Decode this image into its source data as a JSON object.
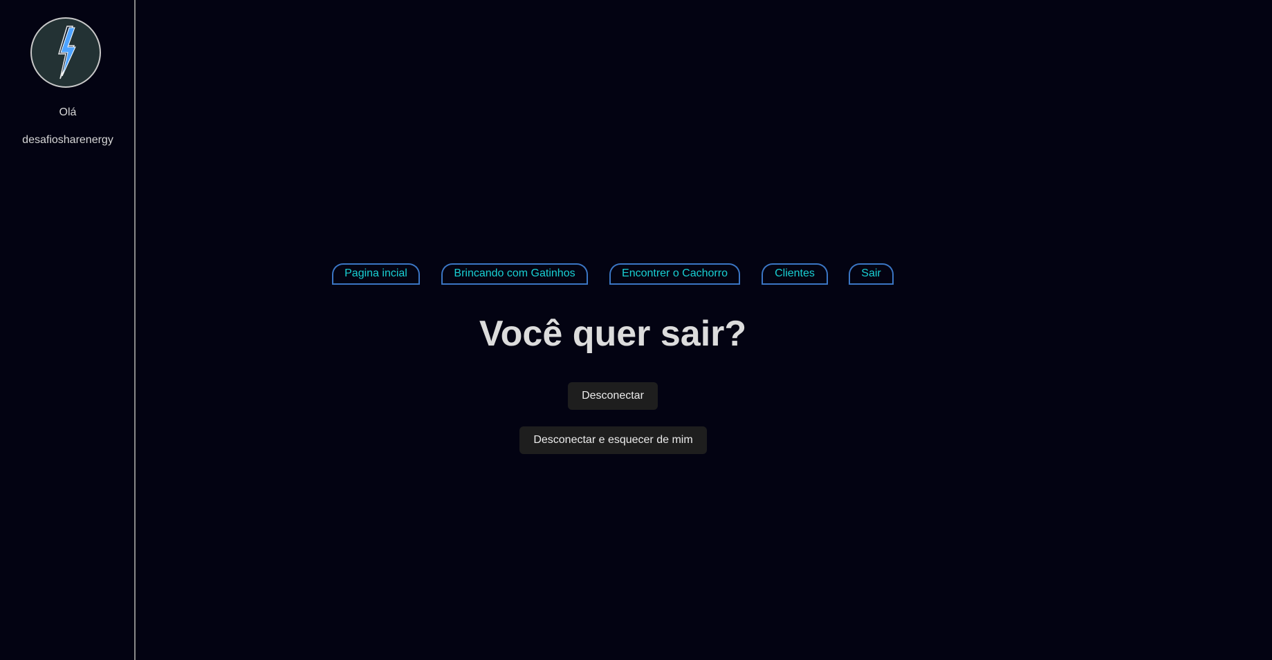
{
  "sidebar": {
    "avatar_icon": "lightning-bolt-icon",
    "greeting": "Olá",
    "username": "desafiosharenergy"
  },
  "nav": {
    "items": [
      {
        "label": "Pagina incial"
      },
      {
        "label": "Brincando com Gatinhos"
      },
      {
        "label": "Encontrer o Cachorro"
      },
      {
        "label": "Clientes"
      },
      {
        "label": "Sair"
      }
    ]
  },
  "main": {
    "title": "Você quer sair?",
    "logout_label": "Desconectar",
    "logout_forget_label": "Desconectar e esquecer de mim"
  },
  "colors": {
    "background": "#030312",
    "nav_text": "#19d0d4",
    "nav_border": "#3b76c5",
    "button_bg": "#1e1e1e",
    "avatar_bg": "#233234",
    "bolt": "#4ea3ff"
  }
}
